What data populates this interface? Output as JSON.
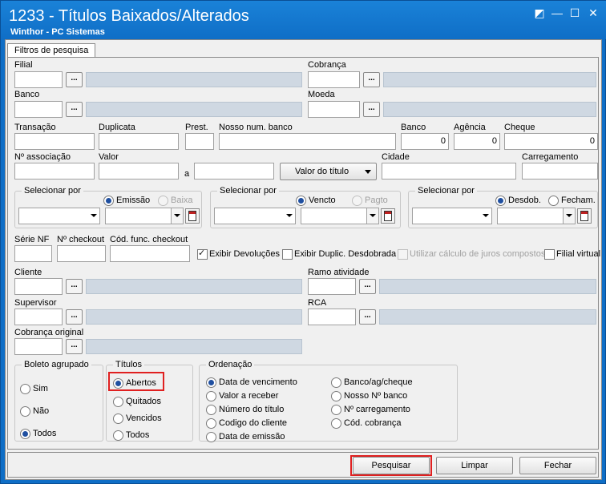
{
  "window": {
    "title": "1233 - Títulos Baixados/Alterados",
    "subtitle": "Winthor - PC Sistemas",
    "controls": [
      "◩",
      "—",
      "☐",
      "✕"
    ]
  },
  "tab": {
    "label": "Filtros de pesquisa"
  },
  "fields": {
    "filial": "Filial",
    "cobranca": "Cobrança",
    "banco": "Banco",
    "moeda": "Moeda",
    "transacao": "Transação",
    "duplicata": "Duplicata",
    "prest": "Prest.",
    "nosso_num_banco": "Nosso num. banco",
    "banco2": "Banco",
    "agencia": "Agência",
    "cheque": "Cheque",
    "banco2_value": "0",
    "agencia_value": "0",
    "cheque_value": "0",
    "n_associacao": "Nº associação",
    "valor": "Valor",
    "a": "a",
    "valor_do_titulo": "Valor do título",
    "cidade": "Cidade",
    "carregamento": "Carregamento",
    "serie_nf": "Série NF",
    "n_checkout": "Nº checkout",
    "cod_func_checkout": "Cód. func. checkout",
    "cliente": "Cliente",
    "ramo_atividade": "Ramo atividade",
    "supervisor": "Supervisor",
    "rca": "RCA",
    "cobranca_original": "Cobrança original"
  },
  "dots_label": "...",
  "selecionar": [
    {
      "label": "Selecionar por",
      "opt1": "Emissão",
      "opt2": "Baixa"
    },
    {
      "label": "Selecionar por",
      "opt1": "Vencto",
      "opt2": "Pagto"
    },
    {
      "label": "Selecionar por",
      "opt1": "Desdob.",
      "opt2": "Fecham."
    }
  ],
  "checks": {
    "exibir_devolucoes": "Exibir Devoluções",
    "exibir_duplic": "Exibir Duplic. Desdobrada",
    "juros": "Utilizar cálculo de juros compostos",
    "filial_virtual": "Filial virtual"
  },
  "boleto": {
    "label": "Boleto agrupado",
    "options": [
      "Sim",
      "Não",
      "Todos"
    ]
  },
  "titulos": {
    "label": "Títulos",
    "options": [
      "Abertos",
      "Quitados",
      "Vencidos",
      "Todos"
    ]
  },
  "ordenacao": {
    "label": "Ordenação",
    "col1": [
      "Data de vencimento",
      "Valor a receber",
      "Número do título",
      "Codigo do cliente",
      "Data de emissão"
    ],
    "col2": [
      "Banco/ag/cheque",
      "Nosso Nº banco",
      "Nº carregamento",
      "Cód. cobrança"
    ]
  },
  "buttons": {
    "pesquisar": "Pesquisar",
    "limpar": "Limpar",
    "fechar": "Fechar"
  },
  "colors": {
    "titlebar": "#0f6ec6",
    "highlight": "#e02020",
    "readonly": "#cfd8e2"
  }
}
